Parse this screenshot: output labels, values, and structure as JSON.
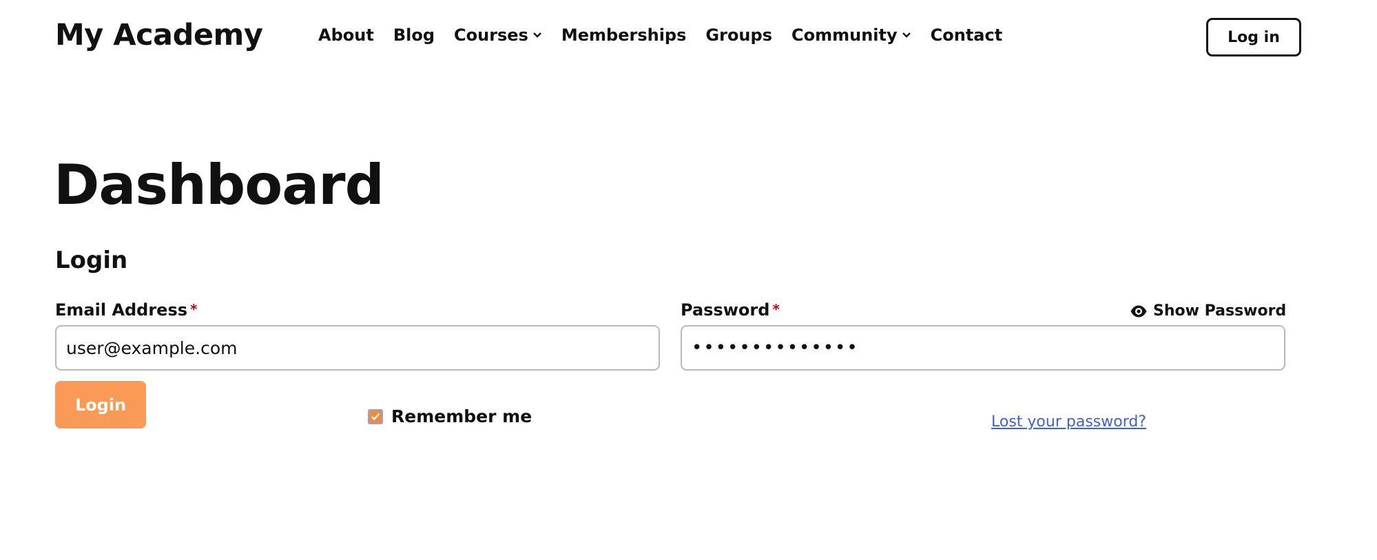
{
  "header": {
    "logo": "My Academy",
    "nav": [
      {
        "label": "About",
        "has_dropdown": false
      },
      {
        "label": "Blog",
        "has_dropdown": false
      },
      {
        "label": "Courses",
        "has_dropdown": true
      },
      {
        "label": "Memberships",
        "has_dropdown": false
      },
      {
        "label": "Groups",
        "has_dropdown": false
      },
      {
        "label": "Community",
        "has_dropdown": true
      },
      {
        "label": "Contact",
        "has_dropdown": false
      }
    ],
    "login_button": "Log in"
  },
  "page": {
    "title": "Dashboard",
    "section_title": "Login"
  },
  "form": {
    "email_label": "Email Address",
    "email_value": "user@example.com",
    "password_label": "Password",
    "password_value": "••••••••••••••",
    "required_mark": "*",
    "show_password": "Show Password",
    "show_password_icon": "eye-icon",
    "submit_label": "Login",
    "remember_label": "Remember me",
    "remember_checked": true,
    "lost_password": "Lost your password?"
  },
  "colors": {
    "accent": "#fb9a56",
    "link": "#3e62d8",
    "required": "#d0021b"
  }
}
